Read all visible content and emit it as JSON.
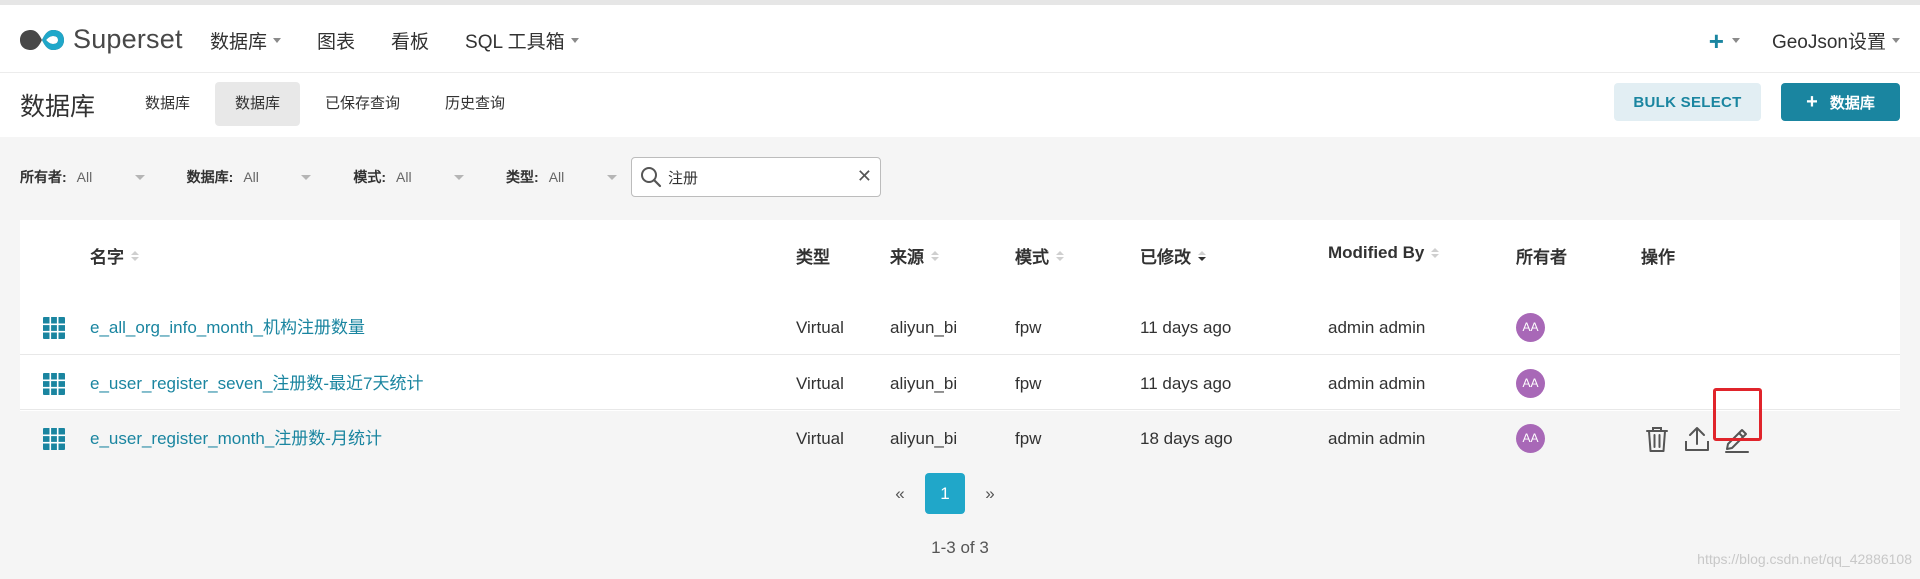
{
  "app": {
    "logo_text": "Superset"
  },
  "nav": {
    "items": [
      {
        "label": "数据库",
        "dropdown": true
      },
      {
        "label": "图表",
        "dropdown": false
      },
      {
        "label": "看板",
        "dropdown": false
      },
      {
        "label": "SQL 工具箱",
        "dropdown": true
      }
    ],
    "plus_label": "+",
    "settings_label": "GeoJson设置"
  },
  "subheader": {
    "title": "数据库",
    "tabs": [
      "数据库",
      "数据库",
      "已保存查询",
      "历史查询"
    ],
    "active_tab_index": 1,
    "bulk_select_label": "BULK SELECT",
    "add_label": "数据库"
  },
  "filters": [
    {
      "label": "所有者:",
      "value": "All"
    },
    {
      "label": "数据库:",
      "value": "All"
    },
    {
      "label": "模式:",
      "value": "All"
    },
    {
      "label": "类型:",
      "value": "All"
    }
  ],
  "search": {
    "value": "注册",
    "placeholder": ""
  },
  "table": {
    "columns": [
      "名字",
      "类型",
      "来源",
      "模式",
      "已修改",
      "Modified By",
      "所有者",
      "操作"
    ],
    "rows": [
      {
        "name": "e_all_org_info_month_机构注册数量",
        "type": "Virtual",
        "source": "aliyun_bi",
        "schema": "fpw",
        "modified": "11 days ago",
        "modified_by": "admin admin",
        "owner": "AA"
      },
      {
        "name": "e_user_register_seven_注册数-最近7天统计",
        "type": "Virtual",
        "source": "aliyun_bi",
        "schema": "fpw",
        "modified": "11 days ago",
        "modified_by": "admin admin",
        "owner": "AA"
      },
      {
        "name": "e_user_register_month_注册数-月统计",
        "type": "Virtual",
        "source": "aliyun_bi",
        "schema": "fpw",
        "modified": "18 days ago",
        "modified_by": "admin admin",
        "owner": "AA"
      }
    ]
  },
  "pagination": {
    "prev": "«",
    "current": "1",
    "next": "»",
    "summary": "1-3 of 3"
  },
  "watermark": "https://blog.csdn.net/qq_42886108",
  "colors": {
    "accent": "#1a85a0",
    "page_active": "#20a7c9",
    "avatar": "#a868b7",
    "highlight": "#e0242b"
  }
}
